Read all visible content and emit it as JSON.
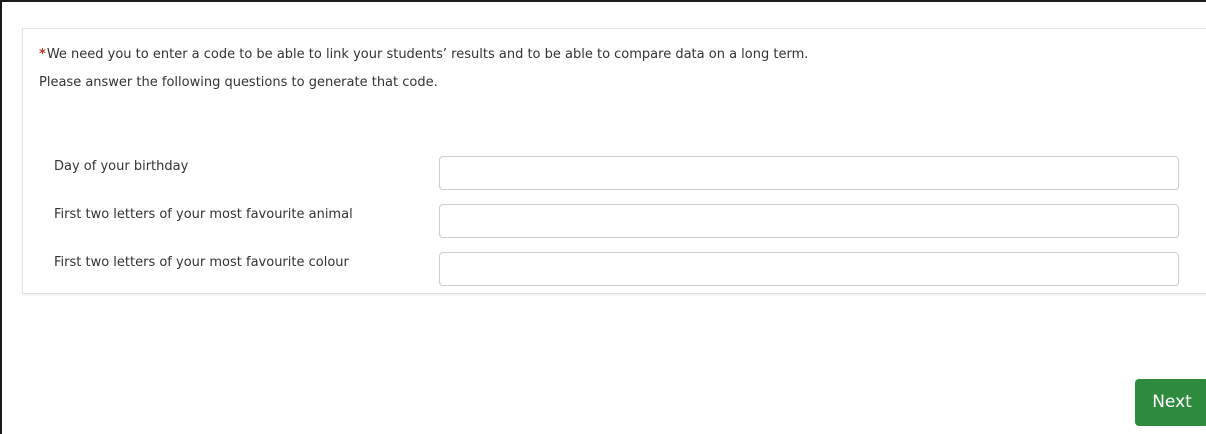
{
  "intro": {
    "required_marker": "*",
    "line1": "We need you to enter a code to be able to link your students’ results and to be able to compare data on a long term.",
    "line2": "Please answer the following questions to generate that code."
  },
  "fields": [
    {
      "label": "Day of your birthday",
      "value": ""
    },
    {
      "label": "First two letters of your most favourite animal",
      "value": ""
    },
    {
      "label": "First two letters of your most favourite colour",
      "value": ""
    }
  ],
  "buttons": {
    "next_label": "Next"
  },
  "colors": {
    "required_marker": "#c0392b",
    "primary_button": "#2e8b3e"
  }
}
